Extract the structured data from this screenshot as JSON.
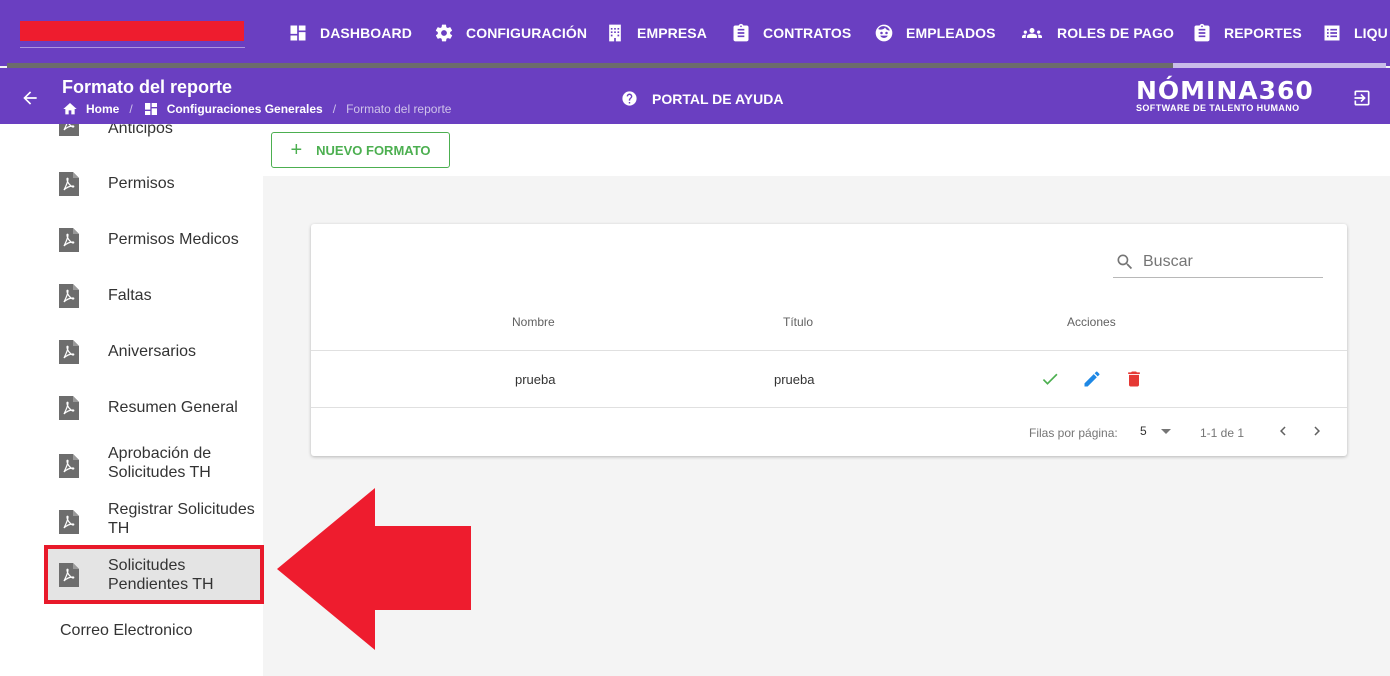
{
  "nav": {
    "items": [
      {
        "label": "DASHBOARD",
        "icon": "dashboard-icon"
      },
      {
        "label": "CONFIGURACIÓN",
        "icon": "gear-icon"
      },
      {
        "label": "EMPRESA",
        "icon": "building-icon"
      },
      {
        "label": "CONTRATOS",
        "icon": "clipboard-icon"
      },
      {
        "label": "EMPLEADOS",
        "icon": "face-icon"
      },
      {
        "label": "ROLES DE PAGO",
        "icon": "people-icon"
      },
      {
        "label": "REPORTES",
        "icon": "clipboard-icon"
      },
      {
        "label": "LIQU",
        "icon": "list-icon"
      }
    ],
    "brand_color": "#6a3fc1"
  },
  "header": {
    "title": "Formato del reporte",
    "breadcrumb": {
      "home": "Home",
      "section": "Configuraciones Generales",
      "current": "Formato del reporte"
    },
    "help": "PORTAL DE AYUDA",
    "logo": {
      "main": "NÓMINA360",
      "sub": "SOFTWARE DE TALENTO HUMANO"
    }
  },
  "sidebar": {
    "items": [
      {
        "label": "Anticipos"
      },
      {
        "label": "Permisos"
      },
      {
        "label": "Permisos Medicos"
      },
      {
        "label": "Faltas"
      },
      {
        "label": "Aniversarios"
      },
      {
        "label": "Resumen General"
      },
      {
        "label": "Aprobación de Solicitudes TH"
      },
      {
        "label": "Registrar Solicitudes TH"
      },
      {
        "label": "Solicitudes Pendientes TH"
      }
    ],
    "plain_item": "Correo Electronico",
    "active_index": 8
  },
  "main": {
    "new_button": "NUEVO FORMATO",
    "search_placeholder": "Buscar",
    "table": {
      "columns": [
        "Nombre",
        "Título",
        "Acciones"
      ],
      "rows": [
        {
          "nombre": "prueba",
          "titulo": "prueba"
        }
      ]
    },
    "pagination": {
      "rows_label": "Filas por página:",
      "rows_value": "5",
      "range": "1-1 de 1"
    }
  },
  "colors": {
    "accent_green": "#4caf50",
    "edit_blue": "#1e88e5",
    "delete_red": "#e53935",
    "annotation_red": "#ee1c2e"
  }
}
